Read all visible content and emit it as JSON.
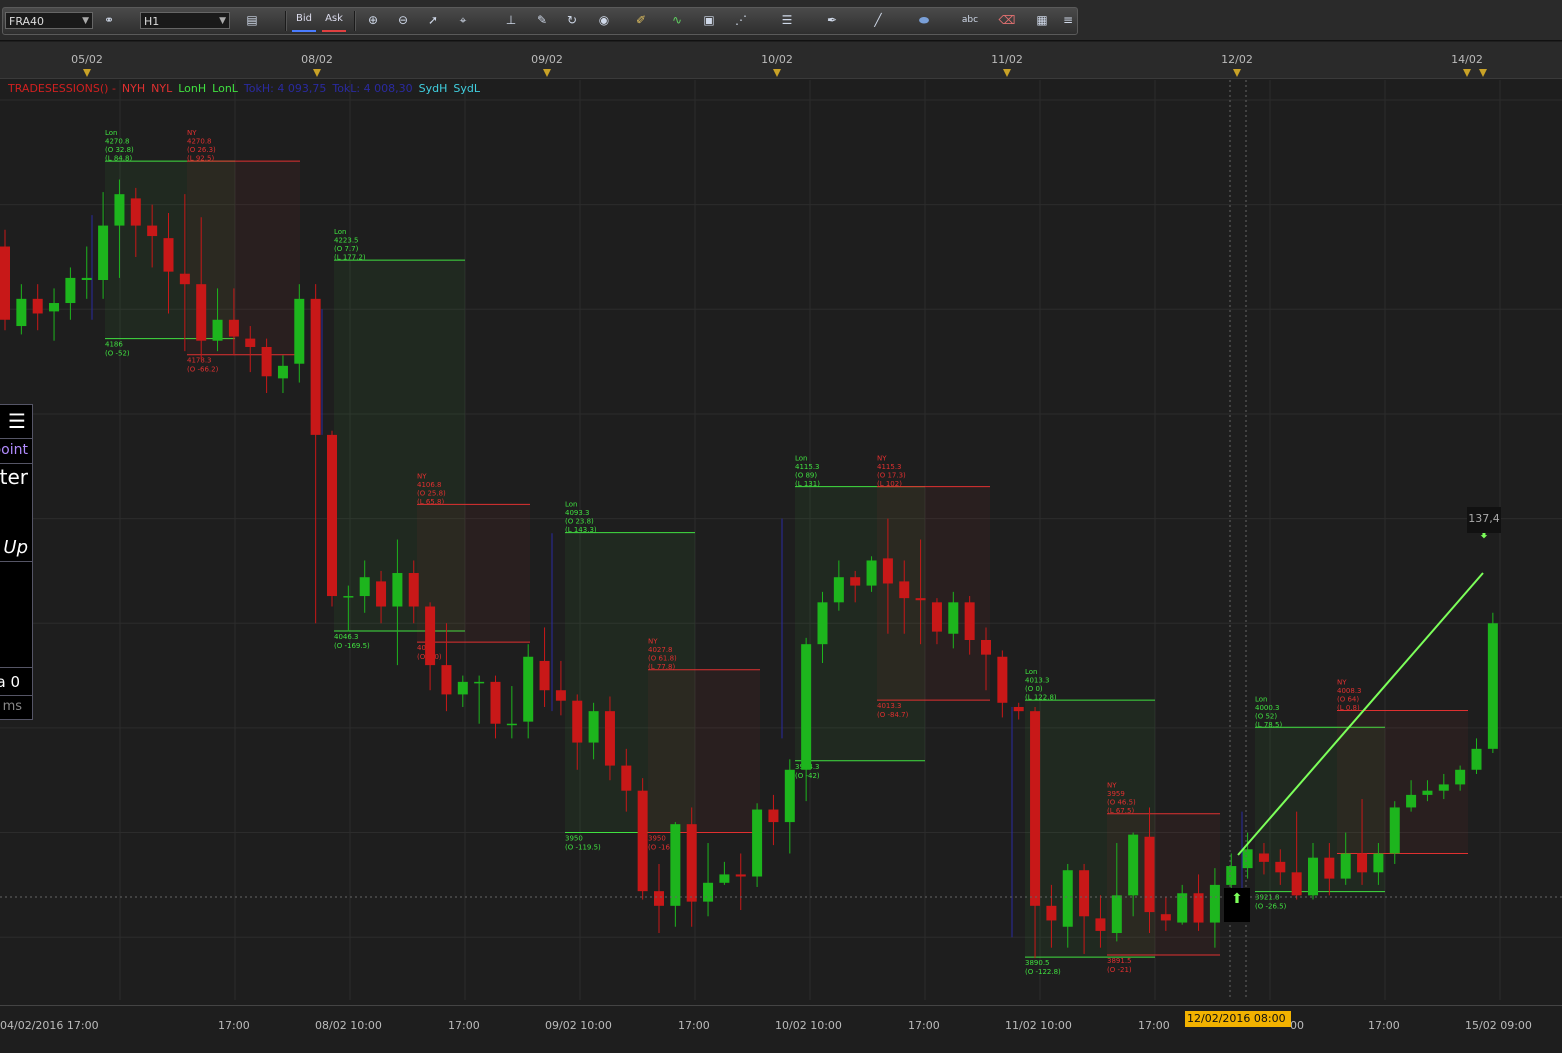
{
  "toolbar": {
    "symbol": "FRA40",
    "timeframe": "H1",
    "bid_label": "Bid",
    "ask_label": "Ask",
    "icons": [
      "link-icon",
      "chart-type-icon",
      "zoom-in-icon",
      "zoom-out-icon",
      "cursor-icon",
      "crosshair-icon",
      "ruler-icon",
      "note-icon",
      "refresh-icon",
      "globe-icon",
      "pencil-icon",
      "indicator-icon",
      "screenshot-icon",
      "grid-icon",
      "lines-icon",
      "pen-icon",
      "line-draw-icon",
      "ellipse-icon",
      "text-icon",
      "eraser-icon",
      "objects-icon"
    ]
  },
  "date_bar": {
    "labels": [
      "05/02",
      "08/02",
      "09/02",
      "10/02",
      "11/02",
      "12/02",
      "14/02"
    ]
  },
  "legend": {
    "items": [
      {
        "text": "TRADESESSIONS() -",
        "color": "#d02020"
      },
      {
        "text": "NYH",
        "color": "#e03030"
      },
      {
        "text": "NYL",
        "color": "#e03030"
      },
      {
        "text": "LonH",
        "color": "#40e040"
      },
      {
        "text": "LonL",
        "color": "#40e040"
      },
      {
        "text": "TokH: 4 093,75",
        "color": "#2a2aa0"
      },
      {
        "text": "TokL: 4 008,30",
        "color": "#2a2aa0"
      },
      {
        "text": "SydH",
        "color": "#40d0e0"
      },
      {
        "text": "SydL",
        "color": "#40d0e0"
      }
    ]
  },
  "side_panel": {
    "menu_icon": "menu-icon",
    "line1": "point",
    "line2": "eter",
    "line3": "Up",
    "line4": "a 0",
    "line5": "ms"
  },
  "x_axis": {
    "labels": [
      "04/02/2016 17:00",
      "17:00",
      "08/02 10:00",
      "17:00",
      "09/02 10:00",
      "17:00",
      "10/02 10:00",
      "17:00",
      "11/02 10:00",
      "17:00",
      "00",
      "17:00",
      "15/02 09:00"
    ],
    "highlight": "12/02/2016 08:00"
  },
  "price_tag": "137,4",
  "colors": {
    "up": "#1db51d",
    "down": "#c81818",
    "lon": "#40e040",
    "ny": "#e03030",
    "tok": "#2a2aa0",
    "accent": "#f2b200"
  },
  "chart_data": {
    "type": "candlestick",
    "title": "FRA40 H1",
    "sessions": [
      {
        "name": "Lon",
        "high": 4270.8,
        "labels": [
          "Lon",
          "4270.8",
          "(O 32.8)",
          "(L 84.8)"
        ],
        "low_labels": [
          "4186",
          "(O -52)"
        ]
      },
      {
        "name": "NY",
        "high": 4270.8,
        "labels": [
          "NY",
          "4270.8",
          "(O 26.3)",
          "(L 92.5)"
        ],
        "low_labels": [
          "4178.3",
          "(O -66.2)"
        ]
      },
      {
        "name": "Lon",
        "high": 4223.5,
        "labels": [
          "Lon",
          "4223.5",
          "(O 7.7)",
          "(L 177.2)"
        ],
        "low_labels": [
          "4046.3",
          "(O -169.5)"
        ]
      },
      {
        "name": "NY",
        "high": 4106.8,
        "labels": [
          "NY",
          "4106.8",
          "(O 25.8)",
          "(L 65.8)"
        ],
        "low_labels": [
          "4041",
          "(O -40)"
        ]
      },
      {
        "name": "Lon",
        "high": 4093.3,
        "labels": [
          "Lon",
          "4093.3",
          "(O 23.8)",
          "(L 143.3)"
        ],
        "low_labels": [
          "3950",
          "(O -119.5)"
        ]
      },
      {
        "name": "NY",
        "high": 4027.8,
        "labels": [
          "NY",
          "4027.8",
          "(O 61.8)",
          "(L 77.8)"
        ],
        "low_labels": [
          "3950",
          "(O -16)"
        ]
      },
      {
        "name": "Lon",
        "high": 4115.3,
        "labels": [
          "Lon",
          "4115.3",
          "(O 89)",
          "(L 131)"
        ],
        "low_labels": [
          "3984.3",
          "(O -42)"
        ]
      },
      {
        "name": "NY",
        "high": 4115.3,
        "labels": [
          "NY",
          "4115.3",
          "(O 17.3)",
          "(L 102)"
        ],
        "low_labels": [
          "4013.3",
          "(O -84.7)"
        ]
      },
      {
        "name": "Lon",
        "high": 4013.3,
        "labels": [
          "Lon",
          "4013.3",
          "(O 0)",
          "(L 122.8)"
        ],
        "low_labels": [
          "3890.5",
          "(O -122.8)"
        ]
      },
      {
        "name": "NY",
        "high": 3959,
        "labels": [
          "NY",
          "3959",
          "(O 46.5)",
          "(L 67.5)"
        ],
        "low_labels": [
          "3891.5",
          "(O -21)"
        ]
      },
      {
        "name": "Lon",
        "high": 4000.3,
        "labels": [
          "Lon",
          "4000.3",
          "(O 52)",
          "(L 78.5)"
        ],
        "low_labels": [
          "3921.8",
          "(O -26.5)"
        ]
      },
      {
        "name": "NY",
        "high": 4008.3,
        "labels": [
          "NY",
          "4008.3",
          "(O 64)",
          "(L 0.8)"
        ],
        "low_labels": []
      }
    ],
    "candles": [
      [
        4230,
        4195,
        4238,
        4190
      ],
      [
        4192,
        4205,
        4212,
        4188
      ],
      [
        4205,
        4198,
        4212,
        4190
      ],
      [
        4199,
        4203,
        4210,
        4185
      ],
      [
        4203,
        4215,
        4220,
        4195
      ],
      [
        4214,
        4215,
        4230,
        4205
      ],
      [
        4214,
        4240,
        4256,
        4205
      ],
      [
        4240,
        4255,
        4262,
        4215
      ],
      [
        4253,
        4240,
        4258,
        4225
      ],
      [
        4240,
        4235,
        4250,
        4220
      ],
      [
        4234,
        4218,
        4246,
        4198
      ],
      [
        4217,
        4212,
        4255,
        4180
      ],
      [
        4212,
        4185,
        4244,
        4176
      ],
      [
        4185,
        4195,
        4210,
        4180
      ],
      [
        4195,
        4187,
        4210,
        4178
      ],
      [
        4186,
        4182,
        4192,
        4170
      ],
      [
        4182,
        4168,
        4186,
        4160
      ],
      [
        4167,
        4173,
        4178,
        4160
      ],
      [
        4174,
        4205,
        4212,
        4165
      ],
      [
        4205,
        4140,
        4212,
        4050
      ],
      [
        4140,
        4063,
        4142,
        4058
      ],
      [
        4063,
        4063,
        4068,
        4046
      ],
      [
        4063,
        4072,
        4080,
        4055
      ],
      [
        4070,
        4058,
        4075,
        4050
      ],
      [
        4058,
        4074,
        4090,
        4030
      ],
      [
        4074,
        4058,
        4080,
        4050
      ],
      [
        4058,
        4030,
        4060,
        4018
      ],
      [
        4030,
        4016,
        4050,
        4008
      ],
      [
        4016,
        4022,
        4025,
        4010
      ],
      [
        4022,
        4022,
        4025,
        4002
      ],
      [
        4022,
        4002,
        4025,
        3995
      ],
      [
        4002,
        4002,
        4020,
        3995
      ],
      [
        4003,
        4034,
        4040,
        3995
      ],
      [
        4032,
        4018,
        4048,
        4010
      ],
      [
        4018,
        4013,
        4032,
        4006
      ],
      [
        4013,
        3993,
        4016,
        3980
      ],
      [
        3993,
        4008,
        4012,
        3985
      ],
      [
        4008,
        3982,
        4015,
        3975
      ],
      [
        3982,
        3970,
        3990,
        3960
      ],
      [
        3970,
        3922,
        3976,
        3918
      ],
      [
        3922,
        3915,
        3935,
        3902
      ],
      [
        3915,
        3954,
        3955,
        3905
      ],
      [
        3954,
        3917,
        3962,
        3905
      ],
      [
        3917,
        3926,
        3945,
        3910
      ],
      [
        3926,
        3930,
        3936,
        3925
      ],
      [
        3930,
        3929,
        3940,
        3913
      ],
      [
        3929,
        3961,
        3964,
        3924
      ],
      [
        3961,
        3955,
        3968,
        3944
      ],
      [
        3955,
        3980,
        3985,
        3940
      ],
      [
        3980,
        4040,
        4043,
        3965
      ],
      [
        4040,
        4060,
        4065,
        4031
      ],
      [
        4060,
        4072,
        4080,
        4056
      ],
      [
        4072,
        4068,
        4075,
        4060
      ],
      [
        4068,
        4080,
        4082,
        4065
      ],
      [
        4081,
        4069,
        4100,
        4045
      ],
      [
        4070,
        4062,
        4080,
        4045
      ],
      [
        4062,
        4061,
        4090,
        4040
      ],
      [
        4060,
        4046,
        4062,
        4040
      ],
      [
        4045,
        4060,
        4065,
        4038
      ],
      [
        4060,
        4042,
        4063,
        4035
      ],
      [
        4042,
        4035,
        4048,
        4018
      ],
      [
        4034,
        4012,
        4037,
        4005
      ],
      [
        4010,
        4008,
        4012,
        4004
      ],
      [
        4008,
        3915,
        4010,
        3890
      ],
      [
        3915,
        3908,
        3925,
        3895
      ],
      [
        3905,
        3932,
        3935,
        3895
      ],
      [
        3932,
        3910,
        3935,
        3892
      ],
      [
        3909,
        3903,
        3920,
        3895
      ],
      [
        3902,
        3920,
        3945,
        3898
      ],
      [
        3920,
        3949,
        3950,
        3910
      ],
      [
        3948,
        3912,
        3962,
        3902
      ],
      [
        3911,
        3908,
        3919,
        3903
      ],
      [
        3907,
        3921,
        3925,
        3906
      ],
      [
        3921,
        3907,
        3930,
        3903
      ],
      [
        3907,
        3925,
        3933,
        3895
      ],
      [
        3925,
        3934,
        3940,
        3918
      ],
      [
        3933,
        3942,
        3950,
        3928
      ],
      [
        3940,
        3936,
        3945,
        3930
      ],
      [
        3936,
        3931,
        3942,
        3925
      ],
      [
        3931,
        3920,
        3960,
        3918
      ],
      [
        3920,
        3938,
        3945,
        3918
      ],
      [
        3938,
        3928,
        3945,
        3920
      ],
      [
        3928,
        3940,
        3950,
        3925
      ],
      [
        3940,
        3931,
        3966,
        3925
      ],
      [
        3931,
        3940,
        3945,
        3925
      ],
      [
        3940,
        3962,
        3965,
        3935
      ],
      [
        3962,
        3968,
        3975,
        3960
      ],
      [
        3968,
        3970,
        3975,
        3965
      ],
      [
        3970,
        3973,
        3978,
        3966
      ],
      [
        3973,
        3980,
        3982,
        3970
      ],
      [
        3980,
        3990,
        3995,
        3978
      ],
      [
        3990,
        4050,
        4055,
        3988
      ]
    ]
  }
}
